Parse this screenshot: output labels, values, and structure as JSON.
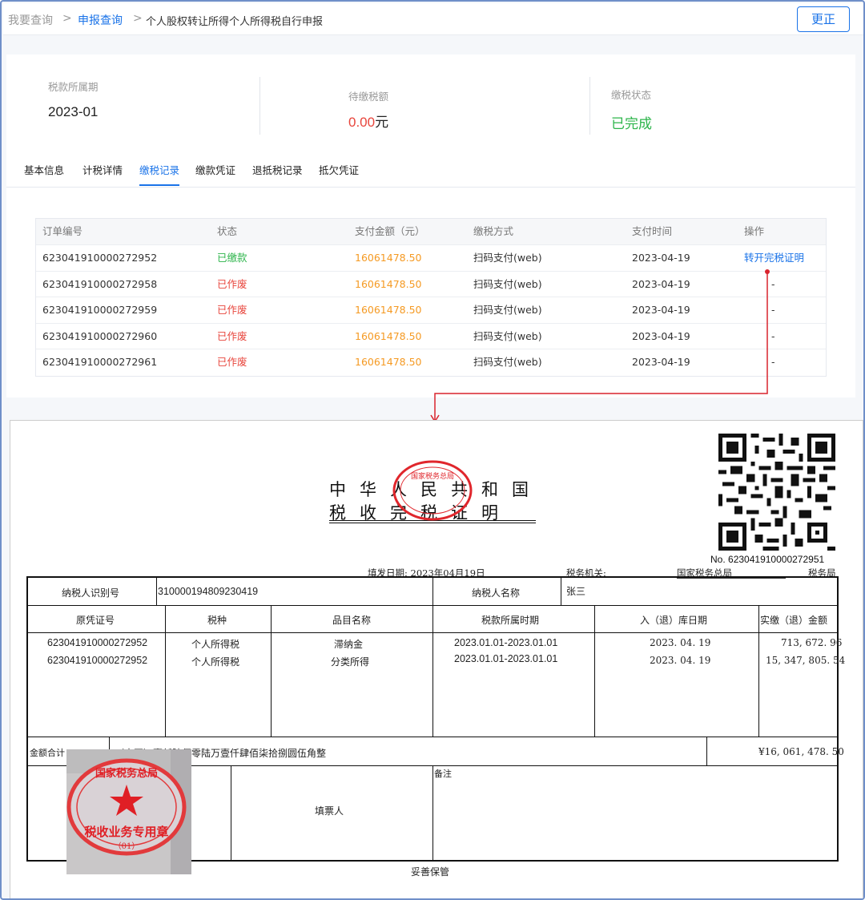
{
  "breadcrumb": {
    "item1": "我要查询",
    "sep": ">",
    "item2": "申报查询",
    "item3": "个人股权转让所得个人所得税自行申报"
  },
  "header": {
    "correct_button": "更正"
  },
  "summary": {
    "period_label": "税款所属期",
    "period_value": "2023-01",
    "due_label": "待缴税额",
    "due_value": "0.00",
    "due_unit": "元",
    "status_label": "缴税状态",
    "status_value": "已完成",
    "colors": {
      "amount": "#e8453c",
      "done": "#2cb44a"
    }
  },
  "tabs": [
    "基本信息",
    "计税详情",
    "缴税记录",
    "缴款凭证",
    "退抵税记录",
    "抵欠凭证"
  ],
  "active_tab": "缴税记录",
  "table": {
    "headers": [
      "订单编号",
      "状态",
      "支付金额（元）",
      "缴税方式",
      "支付时间",
      "操作"
    ],
    "rows": [
      {
        "id": "623041910000272952",
        "status": "已缴款",
        "amount": "16061478.50",
        "method": "扫码支付(web)",
        "time": "2023-04-19",
        "op": "转开完税证明"
      },
      {
        "id": "623041910000272958",
        "status": "已作废",
        "amount": "16061478.50",
        "method": "扫码支付(web)",
        "time": "2023-04-19",
        "op": "-"
      },
      {
        "id": "623041910000272959",
        "status": "已作废",
        "amount": "16061478.50",
        "method": "扫码支付(web)",
        "time": "2023-04-19",
        "op": "-"
      },
      {
        "id": "623041910000272960",
        "status": "已作废",
        "amount": "16061478.50",
        "method": "扫码支付(web)",
        "time": "2023-04-19",
        "op": "-"
      },
      {
        "id": "623041910000272961",
        "status": "已作废",
        "amount": "16061478.50",
        "method": "扫码支付(web)",
        "time": "2023-04-19",
        "op": "-"
      }
    ]
  },
  "certificate": {
    "title_line1": "中华人民共和国",
    "title_line2": "税收完税证明",
    "seal_top_text": "国家税务总局",
    "number_label": "No.",
    "number": "623041910000272951",
    "issue_date_label": "填发日期:",
    "issue_date": "2023年04月19日",
    "authority_label": "税务机关:",
    "authority_value": "国家税务总局",
    "authority_suffix": "税务局",
    "taxpayer_id_label": "纳税人识别号",
    "taxpayer_id": "310000194809230419",
    "taxpayer_name_label": "纳税人名称",
    "taxpayer_name": "张三",
    "columns": [
      "原凭证号",
      "税种",
      "品目名称",
      "税款所属时期",
      "入（退）库日期",
      "实缴（退）金额"
    ],
    "rows": [
      {
        "voucher": "623041910000272952",
        "tax": "个人所得税",
        "item": "滞纳金",
        "period": "2023.01.01-2023.01.01",
        "date": "2023. 04. 19",
        "amount": "713, 672. 96"
      },
      {
        "voucher": "623041910000272952",
        "tax": "个人所得税",
        "item": "分类所得",
        "period": "2023.01.01-2023.01.01",
        "date": "2023. 04. 19",
        "amount": "15, 347, 805. 54"
      }
    ],
    "total_label": "金额合计",
    "total_words": "（大写）壹仟陆佰零陆万壹仟肆佰柒拾捌圆伍角整",
    "total_amount": "¥16, 061, 478. 50",
    "filler_label": "填票人",
    "remark_label": "备注",
    "stamp_text": "税收业务专用章",
    "stamp_sub": "（01）",
    "keep_note": "妥善保管"
  }
}
